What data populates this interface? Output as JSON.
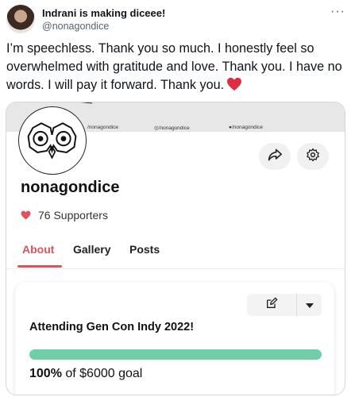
{
  "tweet": {
    "display_name": "Indrani is making diceee!",
    "handle": "@nonagondice",
    "more_icon": "more-horizontal-icon",
    "text": "I’m speechless. Thank you so much. I honestly feel so overwhelmed with gratitude and love. Thank you. I have no words. I will pay it forward. Thank you."
  },
  "profile": {
    "banner_links": [
      "/nonagondice",
      "/nonagondice",
      "/nonagondice"
    ],
    "creator_name": "nonagondice",
    "supporters_text": "76 Supporters",
    "tabs": [
      {
        "label": "About",
        "active": true
      },
      {
        "label": "Gallery",
        "active": false
      },
      {
        "label": "Posts",
        "active": false
      }
    ]
  },
  "goal": {
    "title": "Attending Gen Con Indy 2022!",
    "percent_label": "100%",
    "goal_label": " of $6000 goal",
    "progress": 1.0
  },
  "colors": {
    "accent": "#e0515d",
    "progress": "#6fcfa6",
    "heart": "#e0505a"
  }
}
